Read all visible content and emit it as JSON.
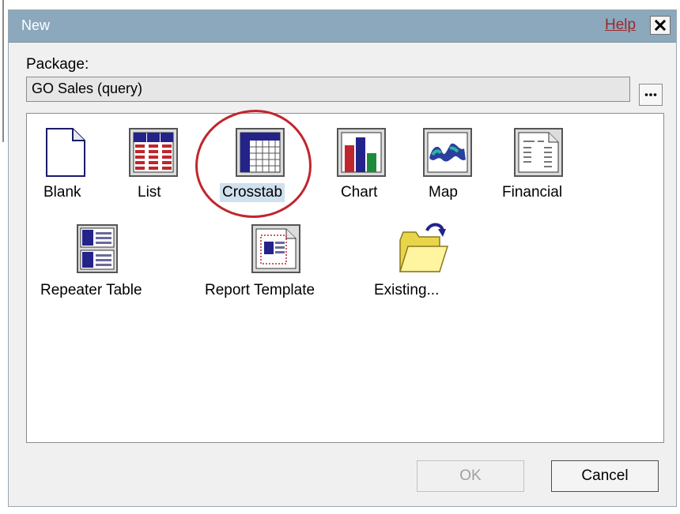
{
  "dialog": {
    "title": "New",
    "help_label": "Help",
    "close_label": "✕"
  },
  "package": {
    "label": "Package:",
    "value": "GO Sales (query)",
    "browse_label": "..."
  },
  "templates": [
    {
      "label": "Blank",
      "icon": "blank-page-icon",
      "selected": false
    },
    {
      "label": "List",
      "icon": "list-icon",
      "selected": false
    },
    {
      "label": "Crosstab",
      "icon": "crosstab-icon",
      "selected": true
    },
    {
      "label": "Chart",
      "icon": "chart-icon",
      "selected": false
    },
    {
      "label": "Map",
      "icon": "map-icon",
      "selected": false
    },
    {
      "label": "Financial",
      "icon": "financial-icon",
      "selected": false
    },
    {
      "label": "Repeater Table",
      "icon": "repeater-table-icon",
      "selected": false
    },
    {
      "label": "Report Template",
      "icon": "report-template-icon",
      "selected": false
    },
    {
      "label": "Existing...",
      "icon": "open-folder-icon",
      "selected": false
    }
  ],
  "buttons": {
    "ok_label": "OK",
    "ok_enabled": false,
    "cancel_label": "Cancel"
  },
  "colors": {
    "titlebar": "#8ba8bd",
    "selection": "#cfe0ee",
    "highlight_ring": "#c0262d"
  }
}
